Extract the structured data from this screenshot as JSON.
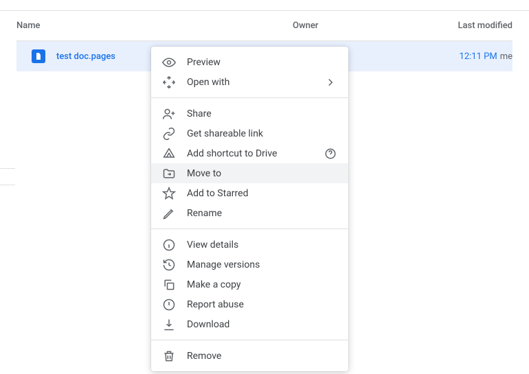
{
  "table": {
    "headers": {
      "name": "Name",
      "owner": "Owner",
      "modified": "Last modified"
    },
    "rows": [
      {
        "filename": "test doc.pages",
        "modified_time": "12:11 PM",
        "modified_by": "me"
      }
    ]
  },
  "menu": {
    "preview": "Preview",
    "open_with": "Open with",
    "share": "Share",
    "get_link": "Get shareable link",
    "add_shortcut": "Add shortcut to Drive",
    "move_to": "Move to",
    "add_starred": "Add to Starred",
    "rename": "Rename",
    "view_details": "View details",
    "manage_versions": "Manage versions",
    "make_copy": "Make a copy",
    "report_abuse": "Report abuse",
    "download": "Download",
    "remove": "Remove"
  }
}
